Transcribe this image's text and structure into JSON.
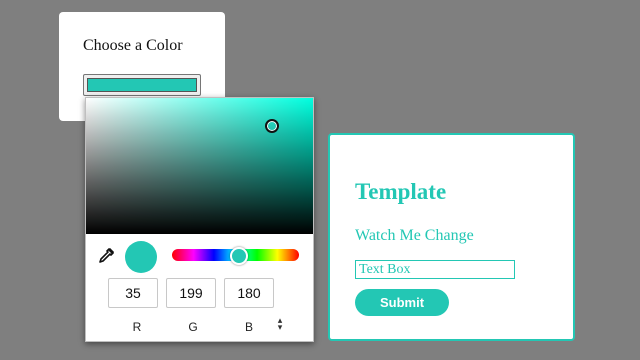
{
  "chooser": {
    "title": "Choose a Color",
    "current_color": "#23c7b4"
  },
  "picker": {
    "hue_color": "#00ffdf",
    "preview_color": "#23c7b4",
    "eyedropper_icon": "eyedropper-icon",
    "rgb": {
      "r_value": "35",
      "g_value": "199",
      "b_value": "180",
      "r_label": "R",
      "g_label": "G",
      "b_label": "B"
    },
    "mode_toggle_icon": "up-down-arrows-icon"
  },
  "template": {
    "title": "Template",
    "subtitle": "Watch Me Change",
    "textbox_placeholder": "Text Box",
    "submit_label": "Submit",
    "accent_color": "#23c7b4"
  },
  "colors": {
    "background": "#7f7f7f",
    "card": "#ffffff"
  }
}
